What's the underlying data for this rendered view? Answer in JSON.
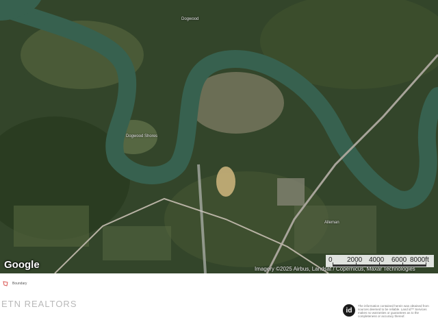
{
  "map": {
    "places": [
      "Dogwood",
      "Dogwood Shores",
      "Alleman"
    ],
    "scale_labels": [
      "0",
      "2000",
      "4000",
      "6000",
      "8000ft"
    ],
    "attribution": "Imagery ©2025 Airbus, Landsat / Copernicus, Maxar Technologies",
    "logo": "Google",
    "colors": {
      "river": "#3a6b58",
      "forest": "#2f4423",
      "field": "#6a7a4a",
      "developed": "#9a8f7a"
    }
  },
  "legend": {
    "icon": "boundary-outline-icon",
    "color": "#d9534f",
    "label": "Boundary"
  },
  "footer": {
    "brand": "ETN REALTORS",
    "badge": "id",
    "disclaimer": "The information contained herein was obtained from sources deemed to be reliable. Land id™ Services makes no warranties or guarantees as to the completeness or accuracy thereof."
  }
}
